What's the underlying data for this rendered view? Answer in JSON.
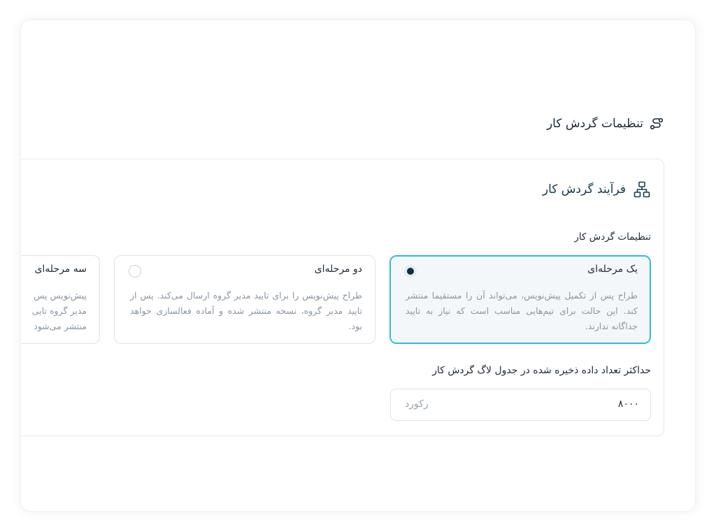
{
  "section": {
    "title": "تنظیمات گردش کار",
    "icon": "route-icon"
  },
  "card": {
    "title": "فرآیند گردش کار",
    "icon": "org-chart-icon",
    "workflow_label": "تنظیمات گردش کار",
    "options": [
      {
        "title": "یک مرحله‌ای",
        "selected": true,
        "description": "طراح پس از تکمیل پیش‌نویس، می‌تواند آن را مستقیما منتشر کند. این حالت برای تیم‌هایی مناسب است که نیاز به تایید جداگانه ندارند."
      },
      {
        "title": "دو مرحله‌ای",
        "selected": false,
        "description": "طراح پیش‌نویس را برای تایید مدیر گروه ارسال می‌کند. پس از تایید مدیر گروه، نسخه منتشر شده و آماده فعالسازی خواهد بود."
      },
      {
        "title": "سه مرحله‌ای",
        "selected": false,
        "desc_lines": [
          "پیش‌نویس پس",
          "مدیر گروه تایی",
          "منتشر می‌شود"
        ]
      }
    ],
    "max_log": {
      "label": "حداکثر تعداد داده ذخیره شده در جدول لاگ گردش کار",
      "value": "۸۰۰۰",
      "unit": "رکورد"
    }
  },
  "colors": {
    "accent": "#2bbfd0",
    "selected_bg": "#f4f7f9",
    "radio_dot": "#0d3242",
    "heading": "#1a3a4a"
  }
}
